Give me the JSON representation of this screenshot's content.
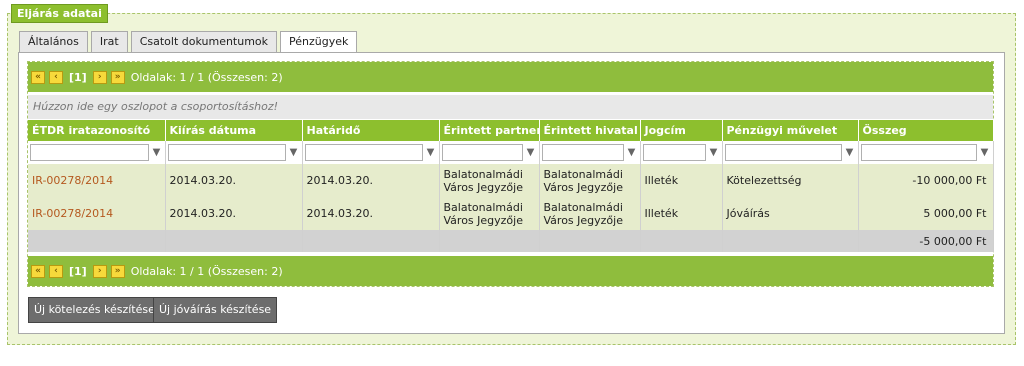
{
  "fieldset": {
    "legend": "Eljárás adatai"
  },
  "tabs": [
    {
      "label": "Általános"
    },
    {
      "label": "Irat"
    },
    {
      "label": "Csatolt dokumentumok"
    },
    {
      "label": "Pénzügyek",
      "active": true
    }
  ],
  "pager": {
    "first": "«",
    "prev": "‹",
    "page": "[1]",
    "next": "›",
    "last": "»",
    "info": "Oldalak: 1 / 1 (Összesen: 2)"
  },
  "group_hint": "Húzzon ide egy oszlopot a csoportosításhoz!",
  "columns": [
    "ÉTDR iratazonosító",
    "Kiírás dátuma",
    "Határidő",
    "Érintett partner",
    "Érintett hivatal",
    "Jogcím",
    "Pénzügyi művelet",
    "Összeg"
  ],
  "rows": [
    {
      "id": "IR-00278/2014",
      "kiiras": "2014.03.20.",
      "hatarido": "2014.03.20.",
      "partner": "Balatonalmádi Város Jegyzője",
      "hivatal": "Balatonalmádi Város Jegyzője",
      "jogcim": "Illeték",
      "muvelet": "Kötelezettség",
      "osszeg": "-10 000,00 Ft"
    },
    {
      "id": "IR-00278/2014",
      "kiiras": "2014.03.20.",
      "hatarido": "2014.03.20.",
      "partner": "Balatonalmádi Város Jegyzője",
      "hivatal": "Balatonalmádi Város Jegyzője",
      "jogcim": "Illeték",
      "muvelet": "Jóváírás",
      "osszeg": "5 000,00 Ft"
    }
  ],
  "total": "-5 000,00 Ft",
  "buttons": {
    "new_obligation": "Új kötelezés készítése",
    "new_credit": "Új jóváírás készítése"
  },
  "colors": {
    "accent": "#8dbf2e",
    "panel_bg": "#eff5d8",
    "row_bg": "#e6eccc",
    "link": "#b5591f"
  },
  "icons": {
    "filter": "filter-icon",
    "first": "first-page-icon",
    "prev": "prev-page-icon",
    "next": "next-page-icon",
    "last": "last-page-icon"
  }
}
